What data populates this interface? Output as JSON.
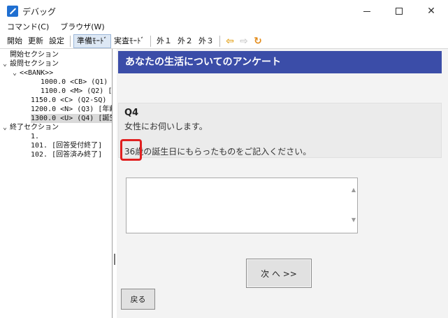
{
  "window": {
    "title": "デバッグ",
    "icons": {
      "app": "pen-app-icon",
      "minimize": "minimize-icon",
      "maximize": "maximize-icon",
      "close": "close-icon"
    },
    "close_glyph": "✕"
  },
  "menu": {
    "items": [
      "コマンド(C)",
      "ブラウザ(W)"
    ]
  },
  "toolbar": {
    "buttons": [
      "開始",
      "更新",
      "設定",
      "準備ﾓｰﾄﾞ",
      "実査ﾓｰﾄﾞ",
      "外１",
      "外２",
      "外３"
    ],
    "pressed": "準備ﾓｰﾄﾞ",
    "arrow_left_glyph": "⇦",
    "arrow_right_glyph": "⇨",
    "refresh_glyph": "↻",
    "icons": {
      "back": "back-arrow-icon",
      "forward": "forward-arrow-icon",
      "refresh": "refresh-icon"
    },
    "colors": {
      "back": "#e3a21a",
      "forward": "#c9c9c9",
      "refresh": "#e38b1a"
    }
  },
  "tree": {
    "chevron": "⌄",
    "items": [
      "開始セクション",
      "設問セクション",
      "<<BANK>>",
      "1000.0 <CB> (Q1) [",
      "1100.0 <M> (Q2) [.",
      "1150.0 <C> (Q2-SQ) [都",
      "1200.0 <N> (Q3) [年齢",
      "1300.0 <U> (Q4) [誕生",
      "終了セクション",
      "1.",
      "101. [回答受付終了]",
      "102. [回答済み終了]"
    ],
    "selected_index": 7
  },
  "survey": {
    "title": "あなたの生活についてのアンケート",
    "question_number": "Q4",
    "question_line1": "女性にお伺いします。",
    "question_line2": "36歳の誕生日にもらったものをご記入ください。",
    "answer_value": "",
    "next_label": "次 へ >>",
    "back_label": "戻る",
    "scroll_up_glyph": "▲",
    "scroll_down_glyph": "▼",
    "colors": {
      "header_bg": "#3b4da8",
      "highlight": "#e02020"
    }
  }
}
